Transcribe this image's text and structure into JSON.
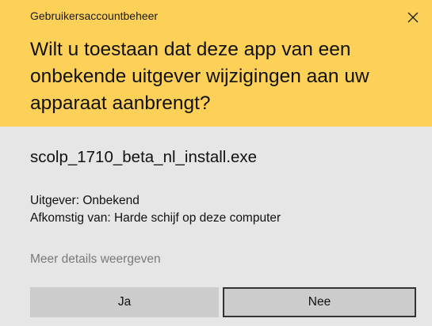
{
  "header": {
    "title": "Gebruikersaccountbeheer",
    "close_icon": "close-icon",
    "question_lines": [
      "Wilt u toestaan dat deze app van een",
      "onbekende uitgever wijzigingen aan uw",
      "apparaat aanbrengt?"
    ]
  },
  "body": {
    "filename": "scolp_1710_beta_nl_install.exe",
    "publisher": "Uitgever: Onbekend",
    "origin": "Afkomstig van: Harde schijf op deze computer",
    "details_link": "Meer details weergeven"
  },
  "buttons": {
    "yes_label": "Ja",
    "no_label": "Nee"
  },
  "colors": {
    "header_bg": "#fdd058",
    "body_bg": "#e6e6e6",
    "button_bg": "#cccccc",
    "focus_border": "#333333",
    "link_color": "#7a7a7a"
  }
}
